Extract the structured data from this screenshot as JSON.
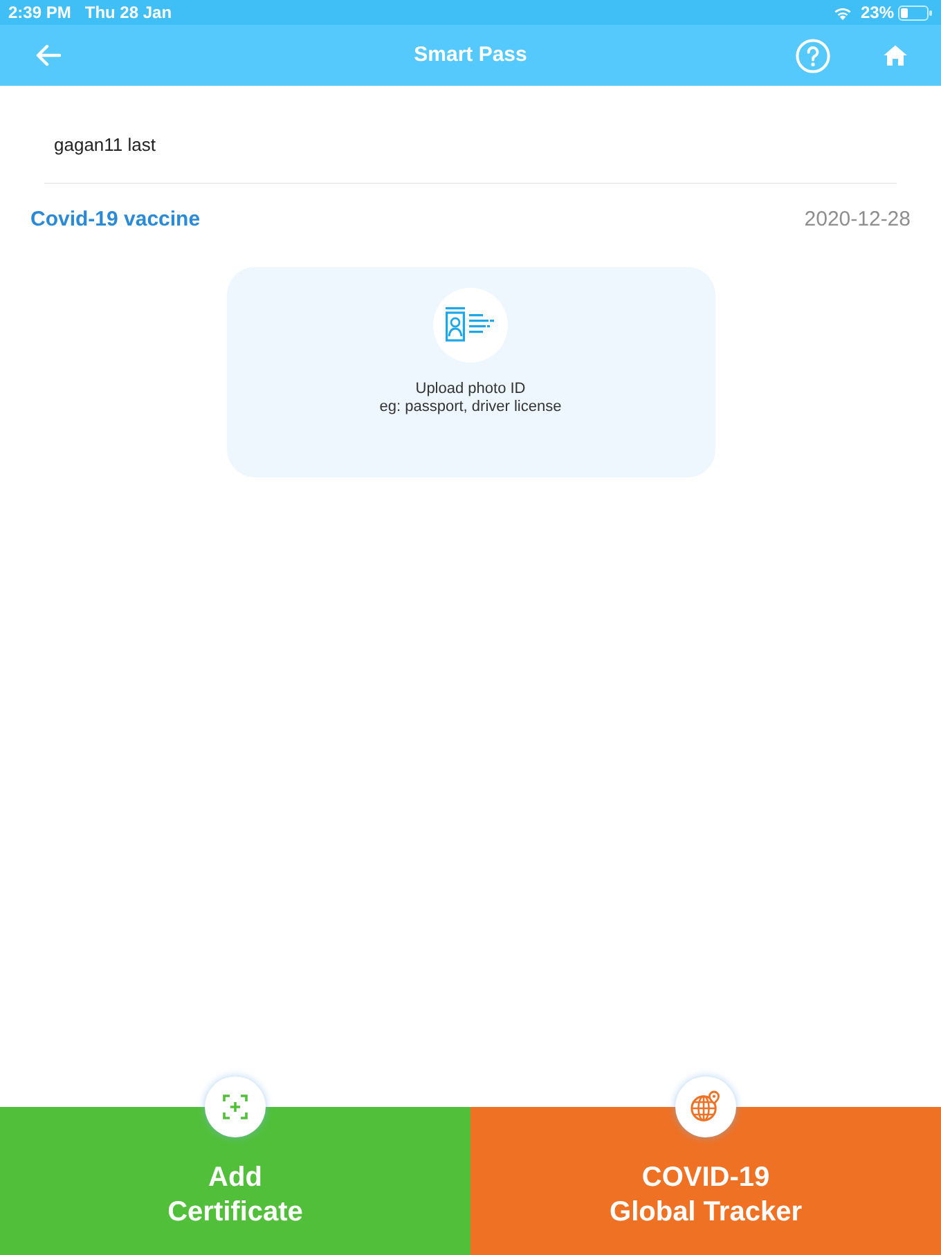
{
  "status_bar": {
    "time": "2:39 PM",
    "date": "Thu 28 Jan",
    "battery": "23%"
  },
  "nav_bar": {
    "title": "Smart Pass"
  },
  "user": {
    "name": "gagan11 last"
  },
  "certificate": {
    "title": "Covid-19 vaccine",
    "date": "2020-12-28"
  },
  "upload_card": {
    "title": "Upload photo ID",
    "hint": "eg: passport, driver license"
  },
  "bottom_actions": [
    {
      "kind": "scan",
      "label": "Add\nCertificate",
      "color": "#52bf3a"
    },
    {
      "kind": "tracker",
      "label": "COVID-19\nGlobal Tracker",
      "color": "#ef7124"
    }
  ]
}
